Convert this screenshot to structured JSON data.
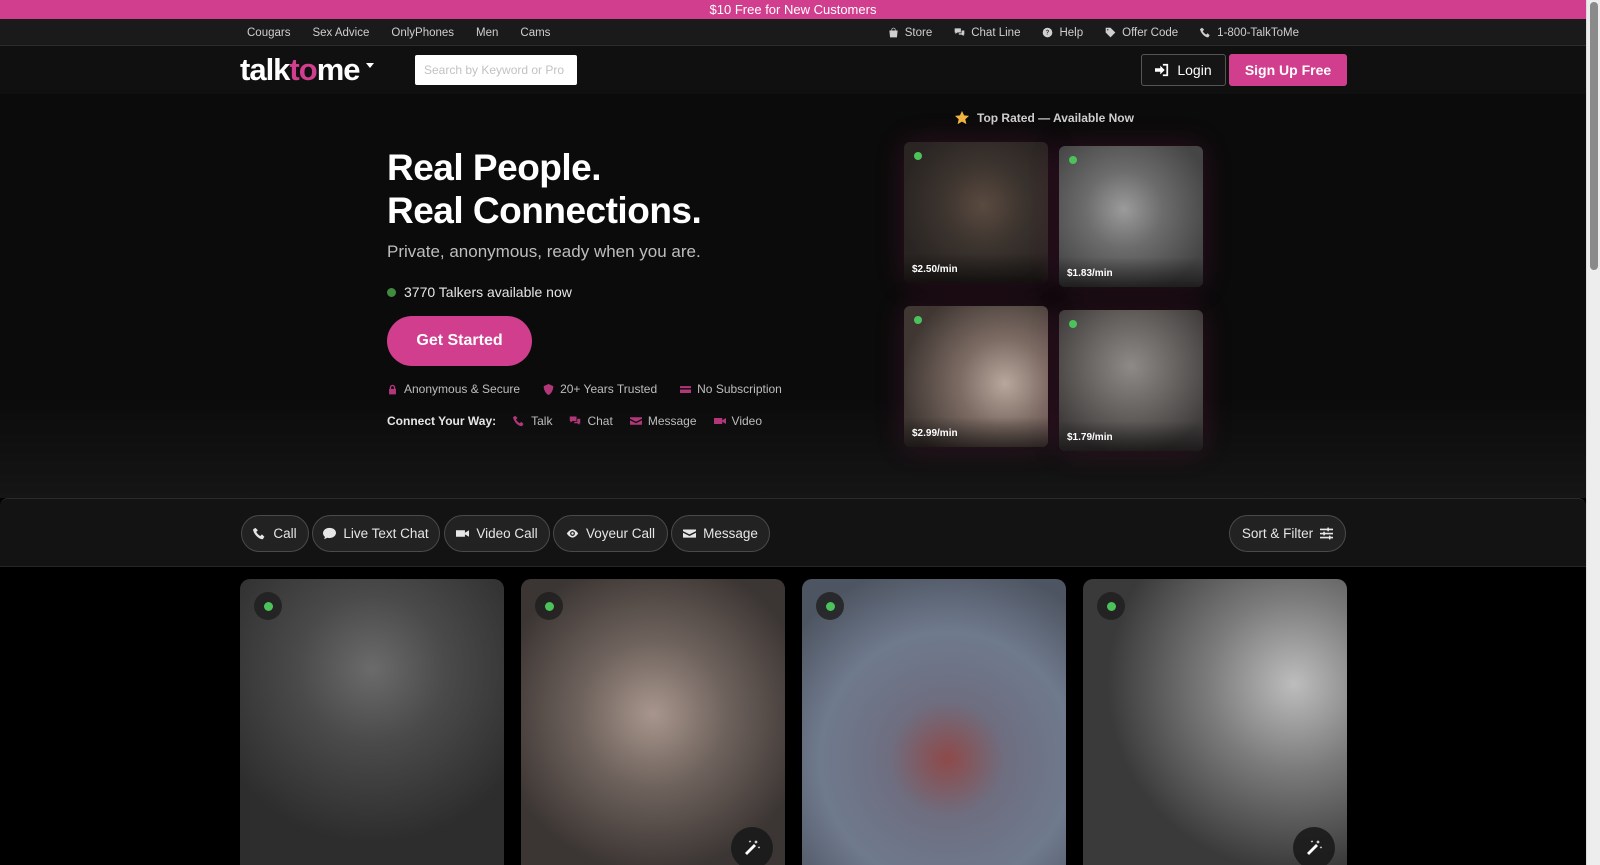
{
  "promo": {
    "text": "$10 Free for New Customers"
  },
  "top_nav": {
    "left": [
      {
        "label": "Cougars"
      },
      {
        "label": "Sex Advice"
      },
      {
        "label": "OnlyPhones"
      },
      {
        "label": "Men"
      },
      {
        "label": "Cams"
      }
    ],
    "right": [
      {
        "label": "Store",
        "icon": "bag-icon"
      },
      {
        "label": "Chat Line",
        "icon": "chat-bubbles-icon"
      },
      {
        "label": "Help",
        "icon": "question-circle-icon"
      },
      {
        "label": "Offer Code",
        "icon": "tag-icon"
      },
      {
        "label": "1-800-TalkToMe",
        "icon": "phone-icon"
      }
    ]
  },
  "header": {
    "logo": {
      "part1": "talk",
      "part2": "to",
      "part3": "me"
    },
    "search_placeholder": "Search by Keyword or Pro",
    "login_label": "Login",
    "signup_label": "Sign Up Free"
  },
  "hero": {
    "title_line1": "Real People.",
    "title_line2": "Real Connections.",
    "subtitle": "Private, anonymous, ready when you are.",
    "available_text": "3770 Talkers available now",
    "cta_label": "Get Started",
    "trust": [
      {
        "label": "Anonymous & Secure",
        "icon": "lock-icon"
      },
      {
        "label": "20+ Years Trusted",
        "icon": "shield-icon"
      },
      {
        "label": "No Subscription",
        "icon": "credit-card-icon"
      }
    ],
    "connect_label": "Connect Your Way:",
    "connect": [
      {
        "label": "Talk",
        "icon": "phone-icon"
      },
      {
        "label": "Chat",
        "icon": "chat-bubbles-icon"
      },
      {
        "label": "Message",
        "icon": "envelope-icon"
      },
      {
        "label": "Video",
        "icon": "video-icon"
      }
    ],
    "top_rated_title": "Top Rated — Available Now",
    "top_rated": [
      {
        "price": "$2.50/min"
      },
      {
        "price": "$1.83/min"
      },
      {
        "price": "$2.99/min"
      },
      {
        "price": "$1.79/min"
      }
    ]
  },
  "filters": {
    "pills": [
      {
        "label": "Call",
        "icon": "phone-icon"
      },
      {
        "label": "Live Text Chat",
        "icon": "chat-bubble-icon"
      },
      {
        "label": "Video Call",
        "icon": "video-icon"
      },
      {
        "label": "Voyeur Call",
        "icon": "eye-icon"
      },
      {
        "label": "Message",
        "icon": "envelope-icon"
      }
    ],
    "sort_label": "Sort & Filter"
  },
  "colors": {
    "accent": "#d13e8e",
    "online": "#4cc25a",
    "background": "#000000"
  }
}
